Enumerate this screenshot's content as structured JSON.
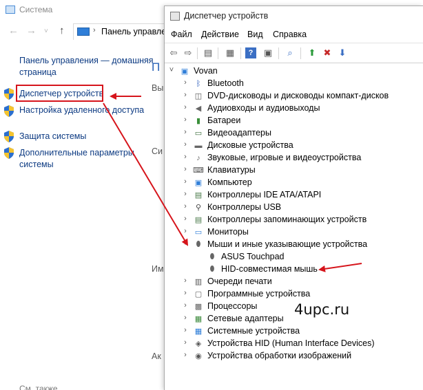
{
  "system_window": {
    "title": "Система",
    "address": "Панель управле",
    "home_link": "Панель управления — домашняя страница",
    "links": [
      {
        "label": "Диспетчер устройств"
      },
      {
        "label": "Настройка удаленного доступа"
      },
      {
        "label": "Защита системы"
      },
      {
        "label": "Дополнительные параметры системы"
      }
    ],
    "see_also": "См. также",
    "fragments": {
      "p": "П",
      "vy": "Вы",
      "si": "Си",
      "im": "Им",
      "ak": "Ак"
    }
  },
  "device_manager": {
    "title": "Диспетчер устройств",
    "menu": [
      "Файл",
      "Действие",
      "Вид",
      "Справка"
    ],
    "root": "Vovan",
    "nodes": [
      {
        "label": "Bluetooth",
        "icon": "bluetooth-icon",
        "expanded": false
      },
      {
        "label": "DVD-дисководы и дисководы компакт-дисков",
        "icon": "dvd-drive-icon",
        "expanded": false
      },
      {
        "label": "Аудиовходы и аудиовыходы",
        "icon": "speaker-icon",
        "expanded": false
      },
      {
        "label": "Батареи",
        "icon": "battery-icon",
        "expanded": false
      },
      {
        "label": "Видеоадаптеры",
        "icon": "display-adapter-icon",
        "expanded": false
      },
      {
        "label": "Дисковые устройства",
        "icon": "disk-drive-icon",
        "expanded": false
      },
      {
        "label": "Звуковые, игровые и видеоустройства",
        "icon": "sound-icon",
        "expanded": false
      },
      {
        "label": "Клавиатуры",
        "icon": "keyboard-icon",
        "expanded": false
      },
      {
        "label": "Компьютер",
        "icon": "computer-icon",
        "expanded": false
      },
      {
        "label": "Контроллеры IDE ATA/ATAPI",
        "icon": "ide-controller-icon",
        "expanded": false
      },
      {
        "label": "Контроллеры USB",
        "icon": "usb-icon",
        "expanded": false
      },
      {
        "label": "Контроллеры запоминающих устройств",
        "icon": "storage-controller-icon",
        "expanded": false
      },
      {
        "label": "Мониторы",
        "icon": "monitor-icon",
        "expanded": false
      },
      {
        "label": "Мыши и иные указывающие устройства",
        "icon": "mouse-icon",
        "expanded": true,
        "children": [
          {
            "label": "ASUS Touchpad",
            "icon": "mouse-icon"
          },
          {
            "label": "HID-совместимая мышь",
            "icon": "mouse-icon"
          }
        ]
      },
      {
        "label": "Очереди печати",
        "icon": "printer-icon",
        "expanded": false
      },
      {
        "label": "Программные устройства",
        "icon": "software-device-icon",
        "expanded": false
      },
      {
        "label": "Процессоры",
        "icon": "processor-icon",
        "expanded": false
      },
      {
        "label": "Сетевые адаптеры",
        "icon": "network-adapter-icon",
        "expanded": false
      },
      {
        "label": "Системные устройства",
        "icon": "system-device-icon",
        "expanded": false
      },
      {
        "label": "Устройства HID (Human Interface Devices)",
        "icon": "hid-icon",
        "expanded": false
      },
      {
        "label": "Устройства обработки изображений",
        "icon": "camera-icon",
        "expanded": false
      }
    ]
  },
  "watermark": "4upc.ru",
  "colors": {
    "annotation": "#d6141b",
    "link": "#0c3a82"
  }
}
